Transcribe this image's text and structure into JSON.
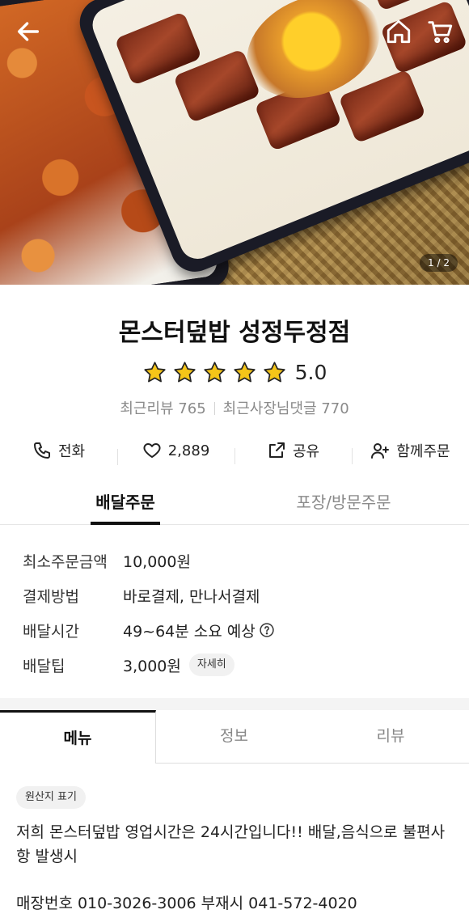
{
  "hero": {
    "page_counter": "1 / 2",
    "back_icon": "arrow-left-icon",
    "home_icon": "home-icon",
    "cart_icon": "cart-icon"
  },
  "store": {
    "name": "몬스터덮밥 성정두정점",
    "rating": "5.0",
    "stars_filled": 5,
    "star_color": "#F5C518",
    "recent_reviews": "최근리뷰 765",
    "recent_owner_replies": "최근사장님댓글 770"
  },
  "actions": [
    {
      "label": "전화",
      "icon": "phone-icon"
    },
    {
      "label": "2,889",
      "icon": "heart-icon"
    },
    {
      "label": "공유",
      "icon": "share-icon"
    },
    {
      "label": "함께주문",
      "icon": "group-order-icon"
    }
  ],
  "order_tabs": {
    "delivery": "배달주문",
    "pickup": "포장/방문주문"
  },
  "info": {
    "min_order_label": "최소주문금액",
    "min_order_value": "10,000원",
    "payment_label": "결제방법",
    "payment_value": "바로결제, 만나서결제",
    "delivery_time_label": "배달시간",
    "delivery_time_value": "49~64분 소요 예상",
    "delivery_tip_label": "배달팁",
    "delivery_tip_value": "3,000원",
    "detail_button": "자세히"
  },
  "menu_tabs": {
    "menu": "메뉴",
    "info": "정보",
    "review": "리뷰"
  },
  "notice": {
    "origin_chip": "원산지 표기",
    "text": "저희 몬스터덮밥 영업시간은 24시간입니다!! 배달,음식으로 불편사항 발생시",
    "phone_line": "매장번호  010-3026-3006 부재시 041-572-4020"
  }
}
